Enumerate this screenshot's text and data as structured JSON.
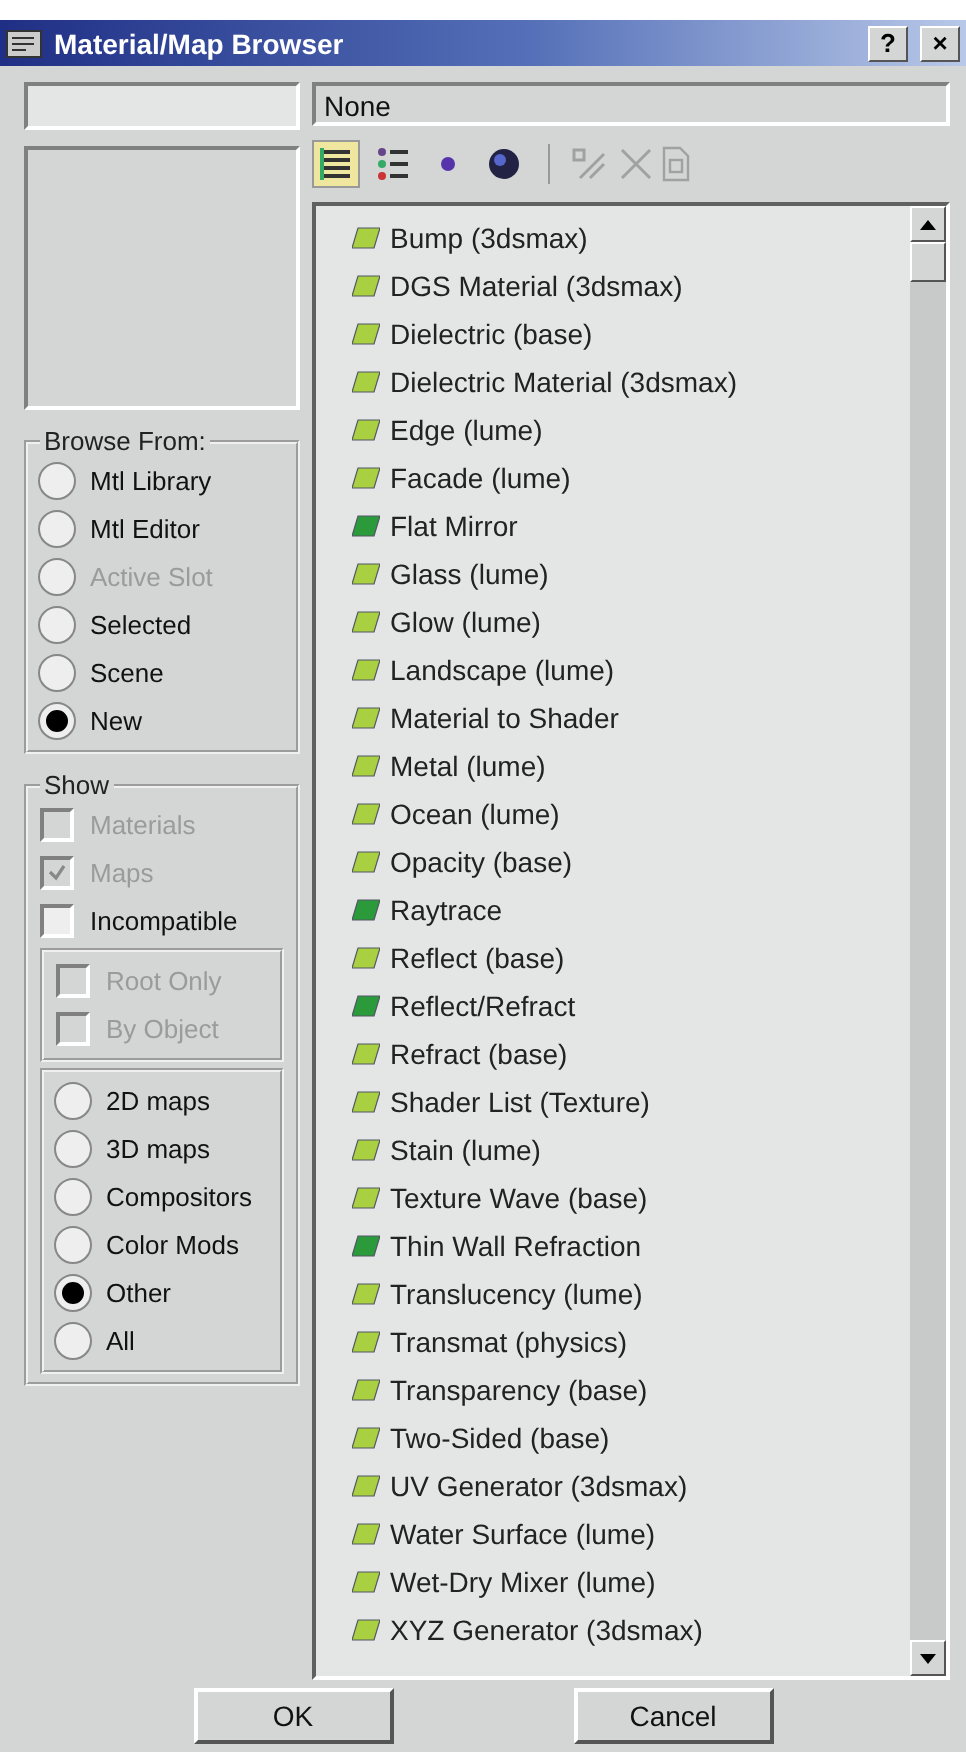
{
  "window": {
    "title": "Material/Map Browser",
    "help": "?",
    "close": "×"
  },
  "current": {
    "value": "None"
  },
  "view_buttons": [
    {
      "kind": "list",
      "selected": true
    },
    {
      "kind": "list-icons",
      "selected": false
    },
    {
      "kind": "small-icons",
      "selected": false
    },
    {
      "kind": "large-icons",
      "selected": false
    }
  ],
  "tools": [
    {
      "kind": "update",
      "disabled": true
    },
    {
      "kind": "delete",
      "disabled": true
    },
    {
      "kind": "clear",
      "disabled": true
    }
  ],
  "browse_from": {
    "title": "Browse From:",
    "options": [
      {
        "label": "Mtl Library",
        "selected": false,
        "disabled": false
      },
      {
        "label": "Mtl Editor",
        "selected": false,
        "disabled": false
      },
      {
        "label": "Active Slot",
        "selected": false,
        "disabled": true
      },
      {
        "label": "Selected",
        "selected": false,
        "disabled": false
      },
      {
        "label": "Scene",
        "selected": false,
        "disabled": false
      },
      {
        "label": "New",
        "selected": true,
        "disabled": false
      }
    ]
  },
  "show": {
    "title": "Show",
    "checks": [
      {
        "label": "Materials",
        "checked": false,
        "disabled": true
      },
      {
        "label": "Maps",
        "checked": true,
        "disabled": true
      },
      {
        "label": "Incompatible",
        "checked": false,
        "disabled": false
      }
    ],
    "checks2": [
      {
        "label": "Root Only",
        "checked": false,
        "disabled": true
      },
      {
        "label": "By Object",
        "checked": false,
        "disabled": true
      }
    ],
    "types": [
      {
        "label": "2D maps",
        "selected": false
      },
      {
        "label": "3D maps",
        "selected": false
      },
      {
        "label": "Compositors",
        "selected": false
      },
      {
        "label": "Color Mods",
        "selected": false
      },
      {
        "label": "Other",
        "selected": true
      },
      {
        "label": "All",
        "selected": false
      }
    ]
  },
  "items": [
    {
      "label": "Bump (3dsmax)",
      "kind": "map"
    },
    {
      "label": "DGS Material (3dsmax)",
      "kind": "map"
    },
    {
      "label": "Dielectric (base)",
      "kind": "map"
    },
    {
      "label": "Dielectric Material (3dsmax)",
      "kind": "map"
    },
    {
      "label": "Edge (lume)",
      "kind": "map"
    },
    {
      "label": "Facade (lume)",
      "kind": "map"
    },
    {
      "label": "Flat Mirror",
      "kind": "material"
    },
    {
      "label": "Glass (lume)",
      "kind": "map"
    },
    {
      "label": "Glow (lume)",
      "kind": "map"
    },
    {
      "label": "Landscape (lume)",
      "kind": "map"
    },
    {
      "label": "Material to Shader",
      "kind": "map"
    },
    {
      "label": "Metal (lume)",
      "kind": "map"
    },
    {
      "label": "Ocean (lume)",
      "kind": "map"
    },
    {
      "label": "Opacity (base)",
      "kind": "map"
    },
    {
      "label": "Raytrace",
      "kind": "material"
    },
    {
      "label": "Reflect (base)",
      "kind": "map"
    },
    {
      "label": "Reflect/Refract",
      "kind": "material"
    },
    {
      "label": "Refract (base)",
      "kind": "map"
    },
    {
      "label": "Shader List (Texture)",
      "kind": "map"
    },
    {
      "label": "Stain (lume)",
      "kind": "map"
    },
    {
      "label": "Texture Wave (base)",
      "kind": "map"
    },
    {
      "label": "Thin Wall Refraction",
      "kind": "material"
    },
    {
      "label": "Translucency (lume)",
      "kind": "map"
    },
    {
      "label": "Transmat (physics)",
      "kind": "map"
    },
    {
      "label": "Transparency (base)",
      "kind": "map"
    },
    {
      "label": "Two-Sided (base)",
      "kind": "map"
    },
    {
      "label": "UV Generator (3dsmax)",
      "kind": "map"
    },
    {
      "label": "Water Surface (lume)",
      "kind": "map"
    },
    {
      "label": "Wet-Dry Mixer (lume)",
      "kind": "map"
    },
    {
      "label": "XYZ Generator (3dsmax)",
      "kind": "map"
    }
  ],
  "buttons": [
    {
      "label": "OK"
    },
    {
      "label": "Cancel"
    }
  ]
}
